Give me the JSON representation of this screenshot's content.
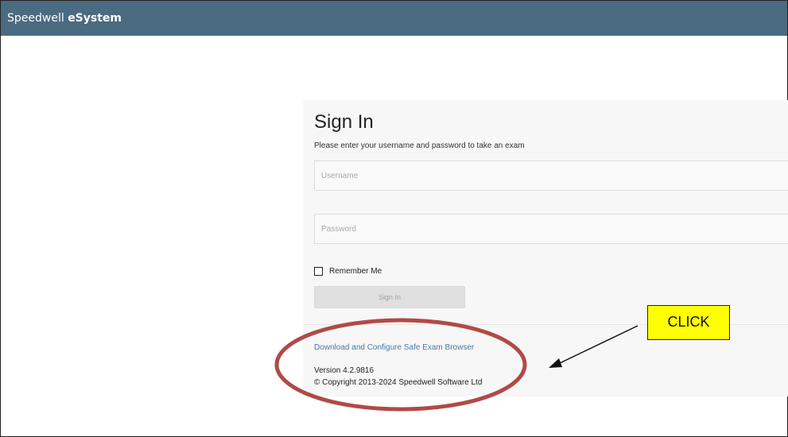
{
  "app": {
    "brand_prefix": "Speedwell ",
    "brand_bold": "eSystem"
  },
  "signin": {
    "title": "Sign In",
    "subtitle": "Please enter your username and password to take an exam",
    "username_placeholder": "Username",
    "password_placeholder": "Password",
    "remember_label": "Remember Me",
    "button_label": "Sign In",
    "seb_link": "Download and Configure Safe Exam Browser",
    "version": "Version 4.2.9816",
    "copyright": "© Copyright 2013-2024 Speedwell Software Ltd"
  },
  "annotation": {
    "callout_text": "CLICK",
    "callout_color": "#ffff00",
    "ellipse_color": "#b04a48"
  },
  "colors": {
    "header_bg": "#4a6b80",
    "link": "#4a78a8"
  }
}
